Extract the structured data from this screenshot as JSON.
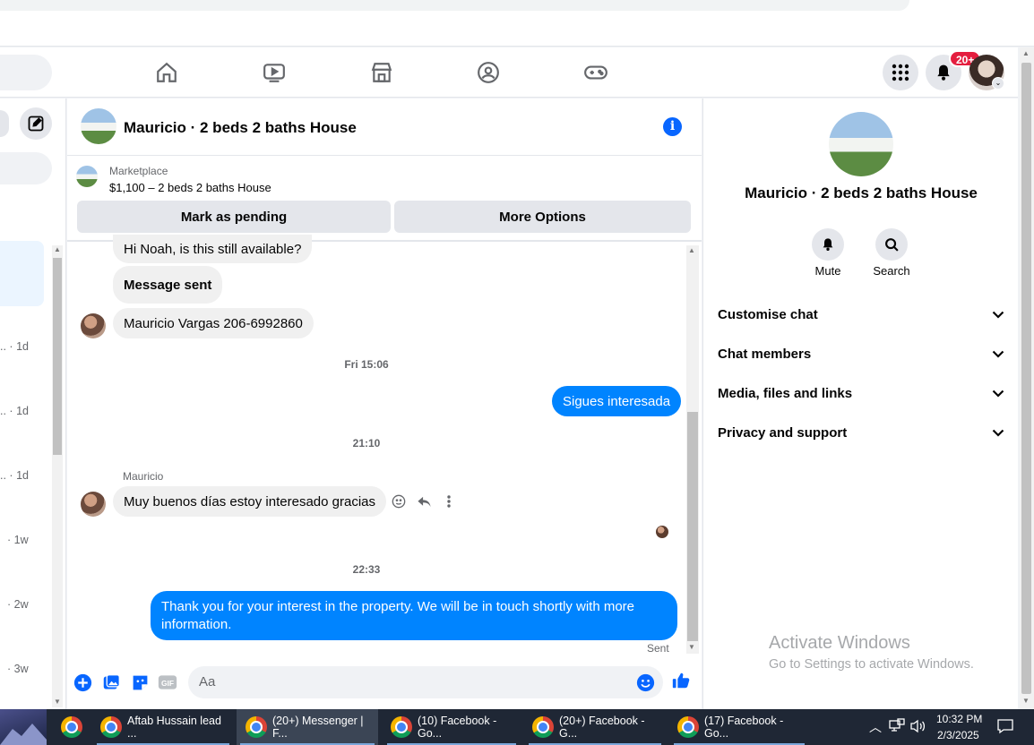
{
  "header": {
    "notification_badge": "20+"
  },
  "left": {
    "times": [
      "1d",
      "1d",
      "1d",
      "1w",
      "2w",
      "3w"
    ]
  },
  "chat": {
    "title": "Mauricio · 2 beds 2 baths House",
    "marketplace_label": "Marketplace",
    "listing": "$1,100 – 2 beds 2 baths House",
    "mark_pending": "Mark as pending",
    "more_options": "More Options",
    "messages": {
      "m1": "Hi Noah, is this still available?",
      "m2": "Message sent",
      "m3": "Mauricio Vargas 206-6992860",
      "time1": "Fri 15:06",
      "m4": "Sigues interesada",
      "time2": "21:10",
      "sender": "Mauricio",
      "m5": "Muy buenos días estoy interesado gracias",
      "time3": "22:33",
      "m6": "Thank you for your interest in the property. We will be in touch shortly with more information.",
      "status": "Sent"
    },
    "composer_placeholder": "Aa"
  },
  "right": {
    "title": "Mauricio · 2 beds 2 baths House",
    "mute": "Mute",
    "search": "Search",
    "menu": [
      "Customise chat",
      "Chat members",
      "Media, files and links",
      "Privacy and support"
    ],
    "activate_title": "Activate Windows",
    "activate_sub": "Go to Settings to activate Windows."
  },
  "taskbar": {
    "items": [
      "Aftab Hussain lead ...",
      "(20+) Messenger | F...",
      "(10) Facebook - Go...",
      "(20+) Facebook - G...",
      "(17) Facebook - Go..."
    ],
    "time": "10:32 PM",
    "date": "2/3/2025"
  },
  "colors": {
    "accent": "#0866ff",
    "outgoing_bubble": "#0084ff",
    "badge": "#e41e3f"
  }
}
